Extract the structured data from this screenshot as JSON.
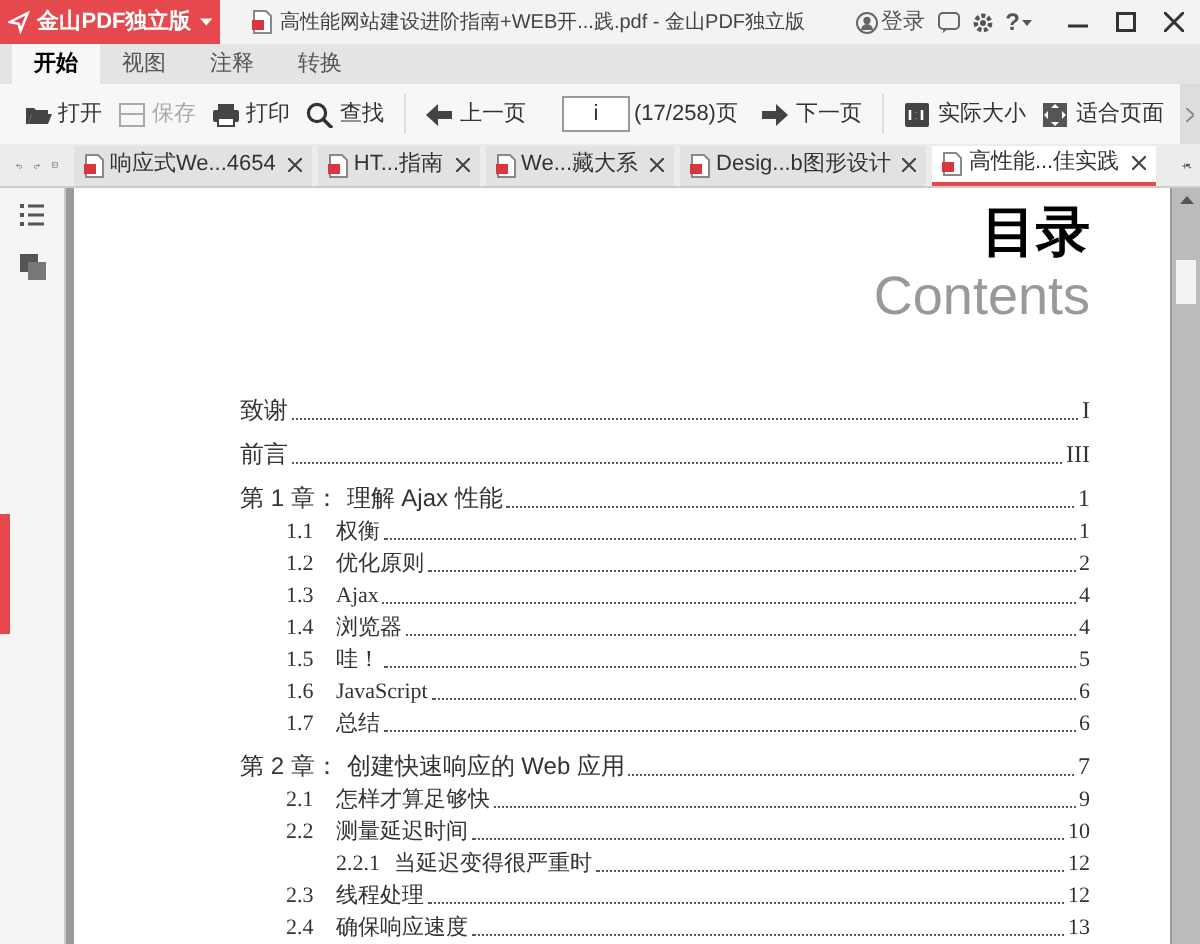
{
  "app_menu": {
    "label": "金山PDF独立版"
  },
  "window": {
    "title": "高性能网站建设进阶指南+WEB开...践.pdf - 金山PDF独立版"
  },
  "account": {
    "label": "登录"
  },
  "help": {
    "label": "?"
  },
  "ribbon_tabs": [
    {
      "label": "开始",
      "selected": true
    },
    {
      "label": "视图",
      "selected": false
    },
    {
      "label": "注释",
      "selected": false
    },
    {
      "label": "转换",
      "selected": false
    }
  ],
  "toolbar": [
    {
      "kind": "open",
      "label": "打开",
      "disabled": false
    },
    {
      "kind": "save",
      "label": "保存",
      "disabled": true
    },
    {
      "kind": "print",
      "label": "打印",
      "disabled": false
    },
    {
      "kind": "find",
      "label": "查找",
      "disabled": false
    }
  ],
  "navigation": {
    "previous": "上一页",
    "page_value": "i",
    "page_count": "(17/258)页",
    "next": "下一页"
  },
  "view_buttons": [
    {
      "kind": "actual",
      "label": "实际大小"
    },
    {
      "kind": "fit",
      "label": "适合页面"
    }
  ],
  "doc_tabs": [
    {
      "label": "响应式We...4654",
      "selected": false
    },
    {
      "label": "HT...指南",
      "selected": false
    },
    {
      "label": "We...藏大系",
      "selected": false
    },
    {
      "label": "Desig...b图形设计",
      "selected": false
    },
    {
      "label": "高性能...佳实践",
      "selected": true
    }
  ],
  "page": {
    "heading": "目录",
    "subheading": "Contents",
    "toc": [
      {
        "title": "致谢",
        "page": "I"
      },
      {
        "title": "前言",
        "page": "III"
      },
      {
        "number": "第 1 章：",
        "title": "理解 Ajax 性能",
        "page": "1",
        "children": [
          {
            "number": "1.1",
            "title": "权衡",
            "page": "1"
          },
          {
            "number": "1.2",
            "title": "优化原则",
            "page": "2"
          },
          {
            "number": "1.3",
            "title": "Ajax",
            "page": "4"
          },
          {
            "number": "1.4",
            "title": "浏览器",
            "page": "4"
          },
          {
            "number": "1.5",
            "title": "哇！",
            "page": "5"
          },
          {
            "number": "1.6",
            "title": "JavaScript",
            "page": "6"
          },
          {
            "number": "1.7",
            "title": "总结",
            "page": "6"
          }
        ]
      },
      {
        "number": "第 2 章：",
        "title": "创建快速响应的 Web 应用",
        "page": "7",
        "children": [
          {
            "number": "2.1",
            "title": "怎样才算足够快",
            "page": "9"
          },
          {
            "number": "2.2",
            "title": "测量延迟时间",
            "page": "10",
            "children": [
              {
                "number": "2.2.1",
                "title": "当延迟变得很严重时",
                "page": "12"
              }
            ]
          },
          {
            "number": "2.3",
            "title": "线程处理",
            "page": "12"
          },
          {
            "number": "2.4",
            "title": "确保响应速度",
            "page": "13"
          }
        ]
      }
    ]
  }
}
